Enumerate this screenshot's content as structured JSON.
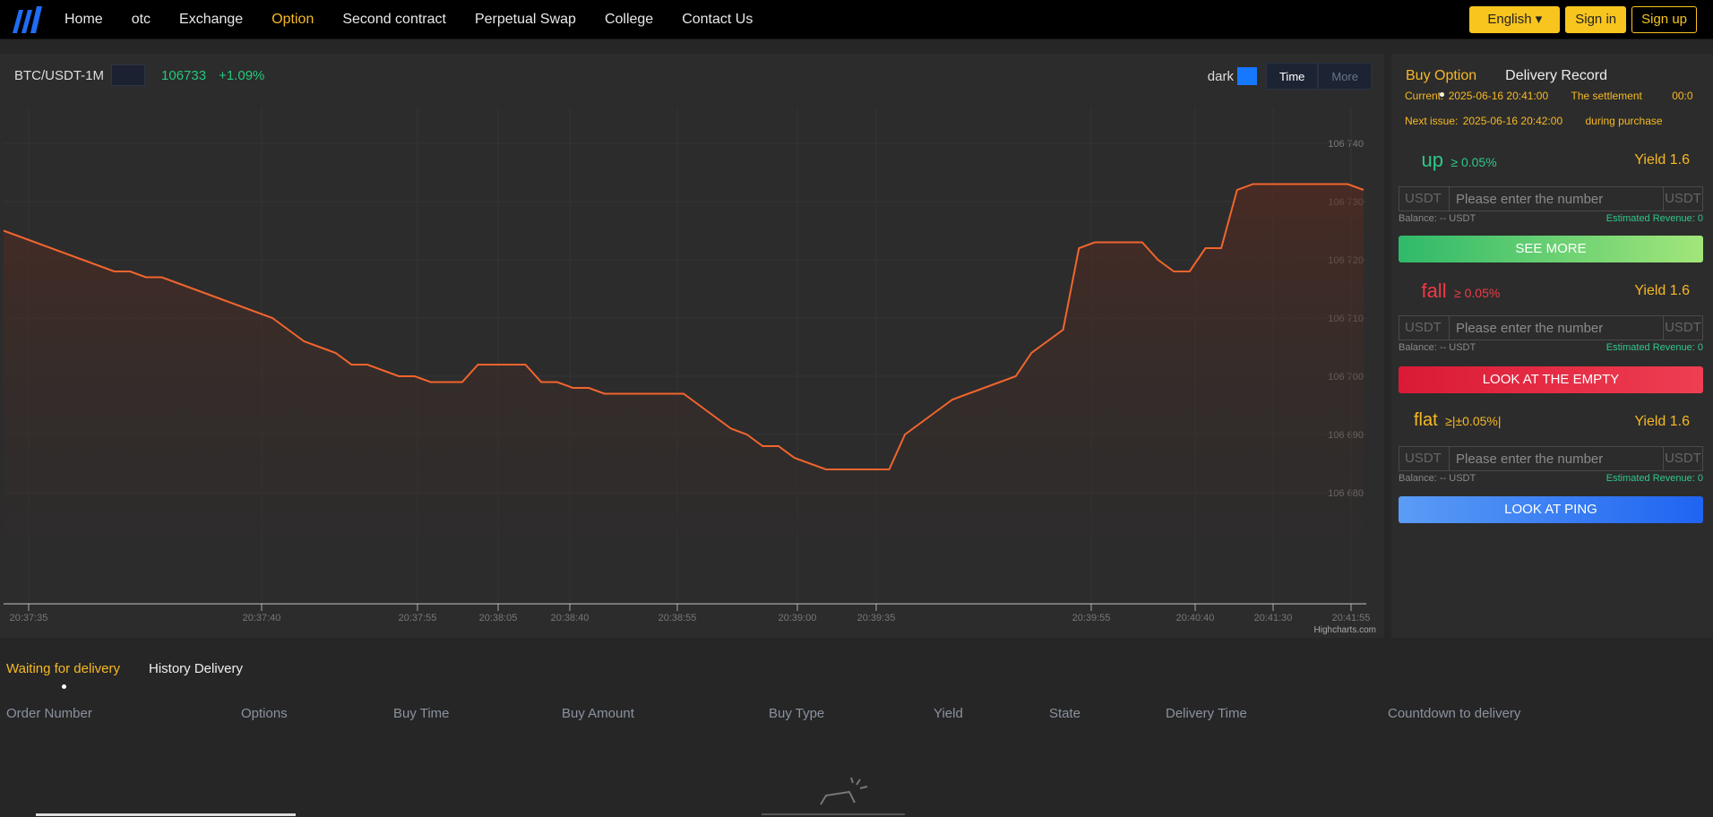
{
  "nav": {
    "links": [
      "Home",
      "otc",
      "Exchange",
      "Option",
      "Second contract",
      "Perpetual Swap",
      "College",
      "Contact Us"
    ],
    "active": "Option",
    "language": "English ▾",
    "sign_in": "Sign in",
    "sign_up": "Sign up"
  },
  "chart_header": {
    "pair": "BTC/USDT-1M",
    "pair_icon": "",
    "price": "106733",
    "change": "+1.09%",
    "theme_label": "dark",
    "theme_icon": "",
    "time_label": "Time",
    "more_label": "More",
    "credit": "Highcharts.com"
  },
  "chart_data": {
    "type": "area",
    "x_ticks": [
      "20:37:35",
      "20:37:40",
      "20:37:55",
      "20:38:05",
      "20:38:40",
      "20:38:55",
      "20:39:00",
      "20:39:35",
      "20:39:55",
      "20:40:40",
      "20:41:30",
      "20:41:55"
    ],
    "y_ticks": [
      "106 740",
      "106 730",
      "106 720",
      "106 710",
      "106 700",
      "106 690",
      "106 680"
    ],
    "ylim": [
      106680,
      106740
    ],
    "line_color": "#f0652e",
    "series": [
      {
        "values": [
          106725,
          106724,
          106723,
          106722,
          106721,
          106720,
          106719,
          106718,
          106718,
          106717,
          106717,
          106716,
          106715,
          106714,
          106713,
          106712,
          106711,
          106710,
          106708,
          106706,
          106705,
          106704,
          106702,
          106702,
          106701,
          106700,
          106700,
          106699,
          106699,
          106699,
          106702,
          106702,
          106702,
          106702,
          106699,
          106699,
          106698,
          106698,
          106697,
          106697,
          106697,
          106697,
          106697,
          106697,
          106695,
          106693,
          106691,
          106690,
          106688,
          106688,
          106686,
          106685,
          106684,
          106684,
          106684,
          106684,
          106684,
          106690,
          106692,
          106694,
          106696,
          106697,
          106698,
          106699,
          106700,
          106704,
          106706,
          106708,
          106722,
          106723,
          106723,
          106723,
          106723,
          106720,
          106718,
          106718,
          106722,
          106722,
          106732,
          106733,
          106733,
          106733,
          106733,
          106733,
          106733,
          106733,
          106732
        ]
      }
    ]
  },
  "side": {
    "tabs": [
      "Buy Option",
      "Delivery Record"
    ],
    "current_label": "Current:",
    "current_time": "2025-06-16 20:41:00",
    "settlement_label": "The settlement",
    "settlement_value": "00:0",
    "next_label": "Next issue:",
    "next_time": "2025-06-16 20:42:00",
    "purchase_label": "during purchase",
    "options": [
      {
        "icon": "",
        "name": "up",
        "range": "≥ 0.05%",
        "suffix_icon": "",
        "yield": "Yield 1.6",
        "button": "SEE MORE"
      },
      {
        "icon": "",
        "name": "fall",
        "range": "≥ 0.05%",
        "suffix_icon": "",
        "yield": "Yield 1.6",
        "button": "LOOK AT THE EMPTY"
      },
      {
        "icon": "",
        "name": "flat",
        "range": "≥|±0.05%|",
        "suffix_icon": "",
        "yield": "Yield 1.6",
        "button": "LOOK AT PING"
      }
    ],
    "currency": "USDT ",
    "placeholder": "Please enter the number",
    "unit": "USDT",
    "balance": "Balance:  -- USDT",
    "revenue": "Estimated Revenue:  0"
  },
  "bottom": {
    "tabs": [
      "Waiting for delivery",
      "History Delivery"
    ],
    "columns": [
      "Order Number",
      "Options",
      "Buy Time",
      "Buy Amount",
      "Buy Type",
      "Yield",
      "State",
      "Delivery Time",
      "Countdown to delivery"
    ]
  }
}
